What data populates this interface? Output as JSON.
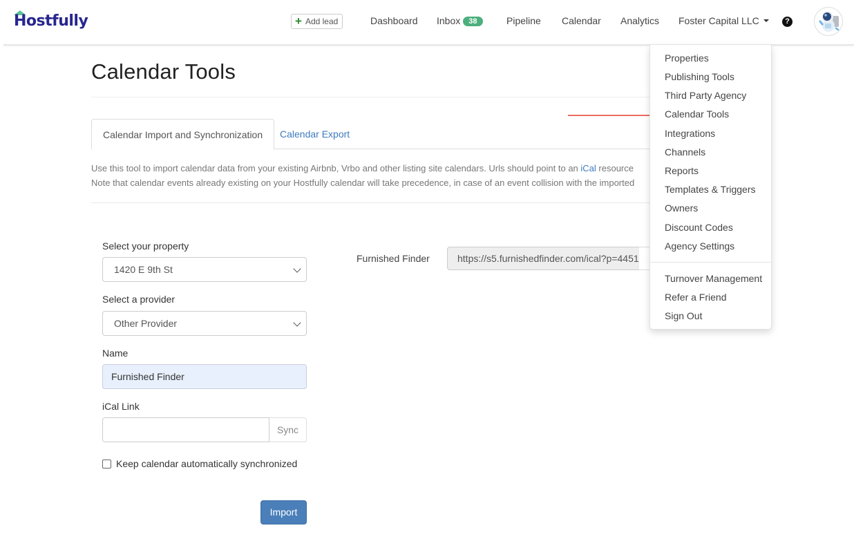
{
  "brand": {
    "name": "Hostfully",
    "logo_color": "#28268e",
    "roof_color": "#5fc19b"
  },
  "navbar": {
    "add_lead_label": "Add lead",
    "links": [
      {
        "label": "Dashboard"
      },
      {
        "label": "Inbox",
        "badge": "38"
      },
      {
        "label": "Pipeline"
      },
      {
        "label": "Calendar"
      },
      {
        "label": "Analytics"
      }
    ],
    "account_label": "Foster Capital LLC",
    "help_icon": "question-circle-icon",
    "avatar_icon": "astronaut-avatar"
  },
  "account_menu": {
    "items": [
      {
        "label": "Properties"
      },
      {
        "label": "Publishing Tools"
      },
      {
        "label": "Third Party Agency"
      },
      {
        "label": "Calendar Tools"
      },
      {
        "label": "Integrations"
      },
      {
        "label": "Channels"
      },
      {
        "label": "Reports"
      },
      {
        "label": "Templates & Triggers"
      },
      {
        "label": "Owners"
      },
      {
        "label": "Discount Codes"
      },
      {
        "label": "Agency Settings"
      }
    ],
    "secondary_items": [
      {
        "label": "Turnover Management"
      },
      {
        "label": "Refer a Friend"
      },
      {
        "label": "Sign Out"
      }
    ],
    "annotation_arrow_color": "#e53b2c"
  },
  "page": {
    "title": "Calendar Tools",
    "tabs": [
      {
        "label": "Calendar Import and Synchronization",
        "active": true
      },
      {
        "label": "Calendar Export",
        "active": false
      }
    ],
    "description": {
      "line1_before": "Use this tool to import calendar data from your existing Airbnb, Vrbo and other listing site calendars. Urls should point to an ",
      "line1_link": "iCal",
      "line1_after": " resource",
      "line2": "Note that calendar events already existing on your Hostfully calendar will take precedence, in case of an event collision with the imported"
    }
  },
  "form": {
    "property_label": "Select your property",
    "property_value": "1420 E 9th St",
    "provider_label": "Select a provider",
    "provider_value": "Other Provider",
    "name_label": "Name",
    "name_value": "Furnished Finder",
    "ical_label": "iCal Link",
    "ical_value": "",
    "sync_label": "Sync",
    "auto_sync_label": "Keep calendar automatically synchronized",
    "auto_sync_checked": false,
    "import_label": "Import",
    "import_color": "#4a7fba"
  },
  "existing_feeds": [
    {
      "name": "Furnished Finder",
      "url": "https://s5.furnishedfinder.com/ical?p=4451"
    }
  ]
}
